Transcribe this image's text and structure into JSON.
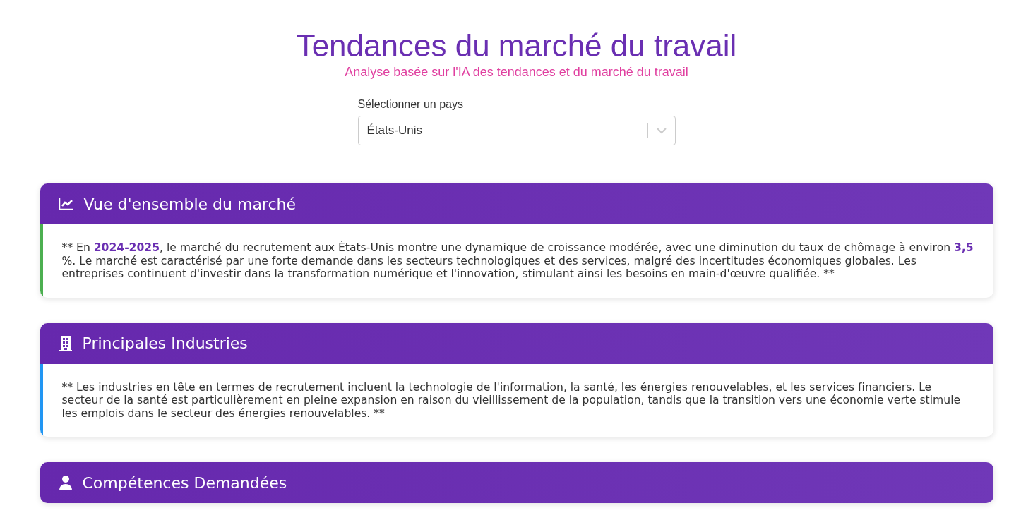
{
  "header": {
    "title": "Tendances du marché du travail",
    "subtitle": "Analyse basée sur l'IA des tendances et du marché du travail"
  },
  "country_select": {
    "label": "Sélectionner un pays",
    "value": "États-Unis"
  },
  "sections": [
    {
      "kind": "chart",
      "title": "Vue d'ensemble du marché",
      "color": "#4caf50",
      "text": "** En **2024-2025**, le marché du recrutement aux États-Unis montre une dynamique de croissance modérée, avec une diminution du taux de chômage à environ **3,5** %. Le marché est caractérisé par une forte demande dans les secteurs technologiques et des services, malgré des incertitudes économiques globales. Les entreprises continuent d'investir dans la transformation numérique et l'innovation, stimulant ainsi les besoins en main-d'œuvre qualifiée. **"
    },
    {
      "kind": "building",
      "title": "Principales Industries",
      "color": "#2196f3",
      "text": "** Les industries en tête en termes de recrutement incluent la technologie de l'information, la santé, les énergies renouvelables, et les services financiers. Le secteur de la santé est particulièrement en pleine expansion en raison du vieillissement de la population, tandis que la transition vers une économie verte stimule les emplois dans le secteur des énergies renouvelables. **"
    },
    {
      "kind": "person",
      "title": "Compétences Demandées"
    }
  ]
}
